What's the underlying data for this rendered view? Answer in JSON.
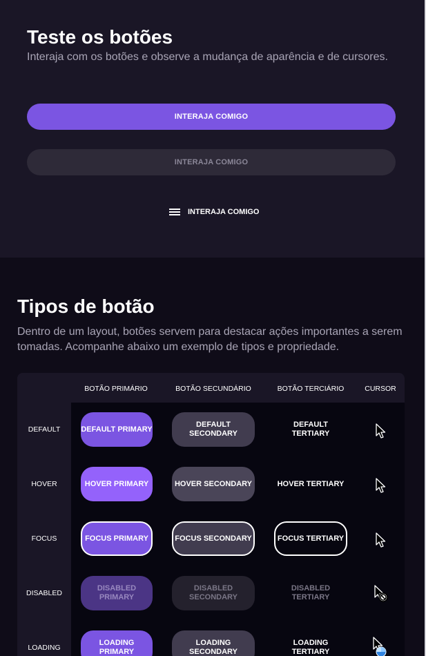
{
  "hero": {
    "title": "Teste os botões",
    "subtitle": "Interaja com os botões e observe a mudança de aparência e de cursores.",
    "primary_label": "INTERAJA COMIGO",
    "secondary_label": "INTERAJA COMIGO",
    "tertiary_label": "INTERAJA COMIGO"
  },
  "types": {
    "title": "Tipos de botão",
    "description": "Dentro de um layout, botões servem para destacar ações importantes a serem tomadas. Acompanhe abaixo um exemplo de tipos e propriedade."
  },
  "table": {
    "columns": [
      "BOTÃO PRIMÁRIO",
      "BOTÃO SECUNDÁRIO",
      "BOTÃO TERCIÁRIO",
      "CURSOR"
    ],
    "rows": [
      {
        "state": "DEFAULT",
        "primary": "DEFAULT PRIMARY",
        "secondary": "DEFAULT SECONDARY",
        "tertiary": "DEFAULT TERTIARY",
        "cursor": "arrow-cursor-icon"
      },
      {
        "state": "HOVER",
        "primary": "HOVER PRIMARY",
        "secondary": "HOVER SECONDARY",
        "tertiary": "HOVER TERTIARY",
        "cursor": "arrow-cursor-icon"
      },
      {
        "state": "FOCUS",
        "primary": "FOCUS PRIMARY",
        "secondary": "FOCUS SECONDARY",
        "tertiary": "FOCUS TERTIARY",
        "cursor": "arrow-cursor-icon"
      },
      {
        "state": "DISABLED",
        "primary": "DISABLED PRIMARY",
        "secondary": "DISABLED SECONDARY",
        "tertiary": "DISABLED TERTIARY",
        "cursor": "not-allowed-cursor-icon"
      },
      {
        "state": "LOADING",
        "primary": "LOADING PRIMARY",
        "secondary": "LOADING SECONDARY",
        "tertiary": "LOADING TERTIARY",
        "cursor": "progress-cursor-icon"
      }
    ]
  },
  "colors": {
    "primary": "#7b55e2",
    "primary_hover": "#9462fb",
    "secondary": "#413c4f",
    "background": "#1a1626",
    "text_muted": "#a9a5b6"
  }
}
